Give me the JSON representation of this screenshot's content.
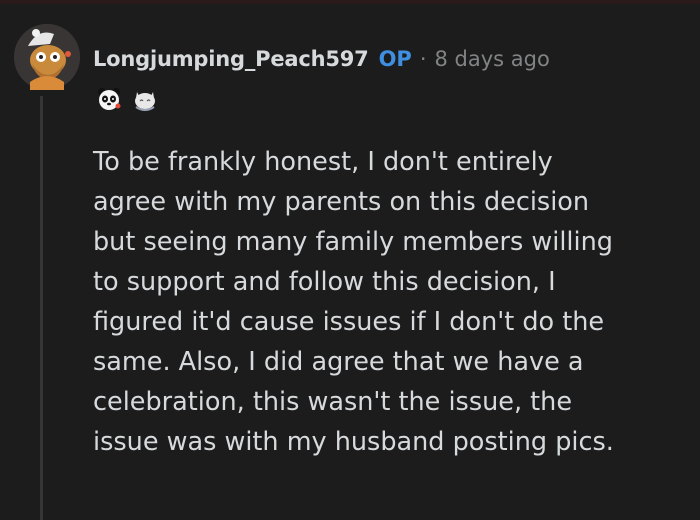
{
  "comment": {
    "username": "Longjumping_Peach597",
    "op_badge": "OP",
    "separator": "·",
    "timestamp": "8 days ago",
    "avatar_icon": "snoo-avatar-icon",
    "awards": [
      {
        "icon": "panda-award-icon"
      },
      {
        "icon": "cat-award-icon"
      }
    ],
    "body_lines": [
      "To be frankly honest, I don't entirely",
      "agree with my parents on this decision",
      "but seeing many family members willing",
      "to support and follow this decision, I",
      "figured it'd cause issues if I don't do the",
      "same. Also, I did agree that we have a",
      "celebration, this wasn't the issue, the",
      "issue was with my husband posting pics."
    ]
  },
  "colors": {
    "background": "#1c1c1c",
    "text": "#d7dadc",
    "op_blue": "#3f8fe0",
    "muted": "#818384",
    "thread_line": "#343536"
  }
}
